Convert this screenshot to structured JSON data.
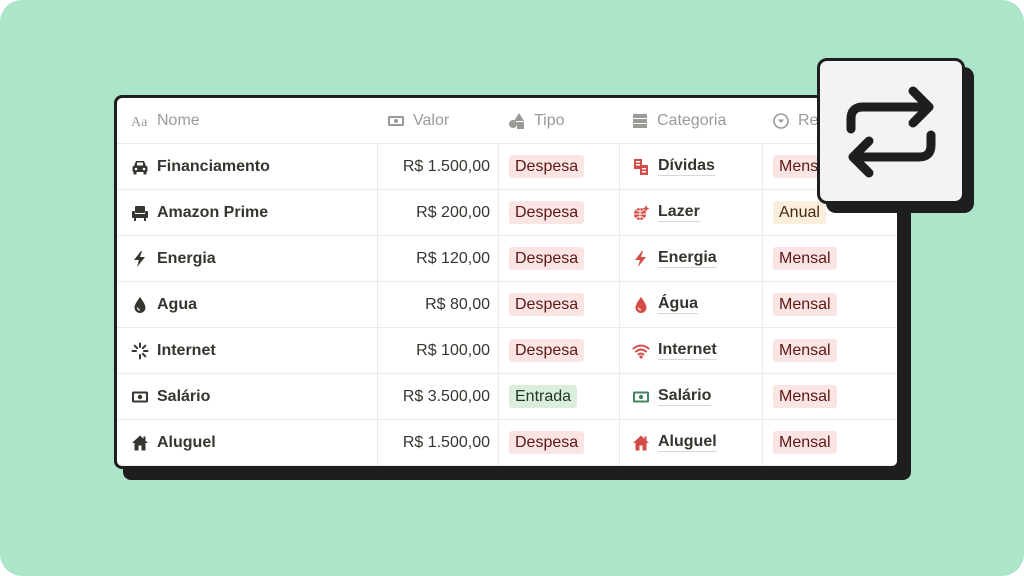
{
  "headers": {
    "nome": "Nome",
    "valor": "Valor",
    "tipo": "Tipo",
    "categoria": "Categoria",
    "recorrencia": "Re"
  },
  "rows": [
    {
      "nome": "Financiamento",
      "nome_icon": "car-icon",
      "valor": "R$ 1.500,00",
      "tipo": "Despesa",
      "categoria": "Dívidas",
      "categoria_icon": "bills-icon",
      "recorrencia": "Mensal"
    },
    {
      "nome": "Amazon Prime",
      "nome_icon": "armchair-icon",
      "valor": "R$ 200,00",
      "tipo": "Despesa",
      "categoria": "Lazer",
      "categoria_icon": "disco-ball-icon",
      "recorrencia": "Anual"
    },
    {
      "nome": "Energia",
      "nome_icon": "lightning-icon",
      "valor": "R$ 120,00",
      "tipo": "Despesa",
      "categoria": "Energia",
      "categoria_icon": "lightning-icon",
      "recorrencia": "Mensal"
    },
    {
      "nome": "Agua",
      "nome_icon": "drop-icon",
      "valor": "R$ 80,00",
      "tipo": "Despesa",
      "categoria": "Água",
      "categoria_icon": "drop-icon",
      "recorrencia": "Mensal"
    },
    {
      "nome": "Internet",
      "nome_icon": "loading-spinner-icon",
      "valor": "R$ 100,00",
      "tipo": "Despesa",
      "categoria": "Internet",
      "categoria_icon": "wifi-icon",
      "recorrencia": "Mensal"
    },
    {
      "nome": "Salário",
      "nome_icon": "banknote-icon",
      "valor": "R$ 3.500,00",
      "tipo": "Entrada",
      "categoria": "Salário",
      "categoria_icon": "banknote-icon",
      "recorrencia": "Mensal"
    },
    {
      "nome": "Aluguel",
      "nome_icon": "house-icon",
      "valor": "R$ 1.500,00",
      "tipo": "Despesa",
      "categoria": "Aluguel",
      "categoria_icon": "house-icon",
      "recorrencia": "Mensal"
    }
  ],
  "colors": {
    "background": "#ade5cb",
    "despesa_tag": "#fbe4e4",
    "entrada_tag": "#dbeddb",
    "anual_tag": "#fbeedd",
    "icon_red": "#d44c47",
    "icon_green": "#448361"
  },
  "repeat_button_icon": "repeat-icon"
}
